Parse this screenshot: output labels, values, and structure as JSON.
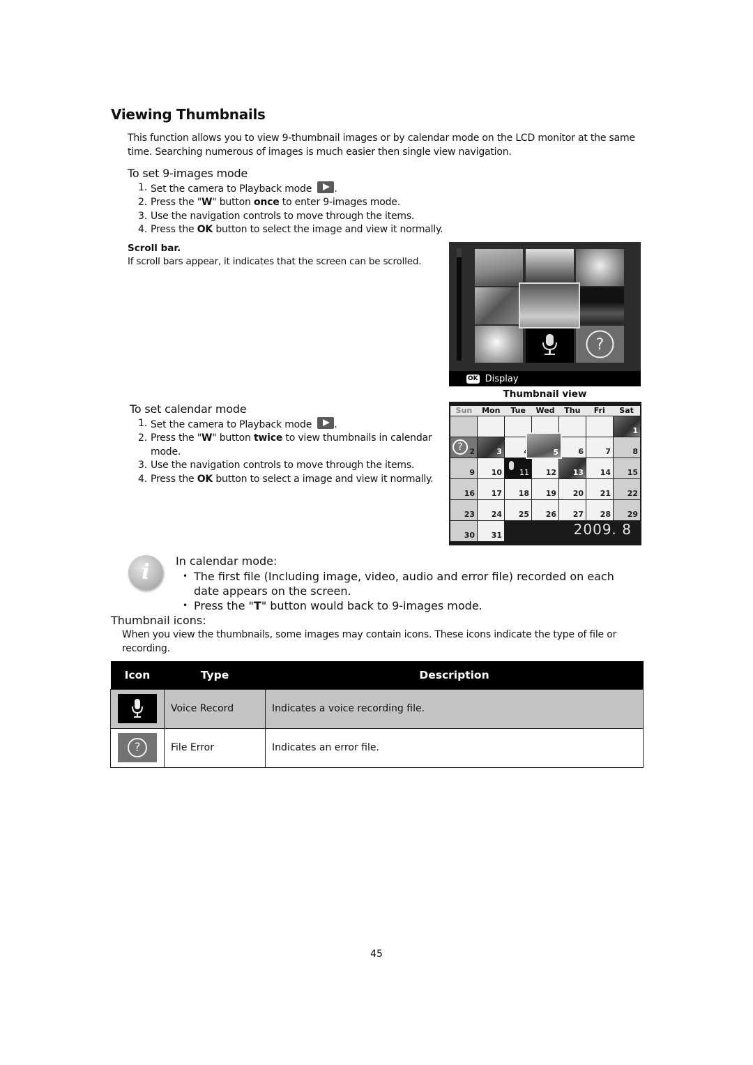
{
  "page": {
    "title": "Viewing Thumbnails",
    "intro": "This function allows you to view 9-thumbnail images or by calendar mode on the LCD monitor at the same time. Searching numerous of images is much easier then single view navigation.",
    "page_number": "45"
  },
  "nine_images": {
    "heading": "To set 9-images mode",
    "steps": [
      {
        "num": "1.",
        "pre": "Set the camera to Playback mode ",
        "bold": "",
        "post": ".",
        "icon": "playback-icon"
      },
      {
        "num": "2.",
        "pre": "Press the \"",
        "bold": "W",
        "mid": "\" button ",
        "bold2": "once",
        "post": " to enter 9-images mode."
      },
      {
        "num": "3.",
        "pre": "Use the navigation controls to move through the items."
      },
      {
        "num": "4.",
        "pre": "Press the ",
        "bold": "OK",
        "post": " button to select the image and view it normally."
      }
    ],
    "scroll_bar_title": "Scroll bar.",
    "scroll_bar_text": "If scroll bars appear, it indicates that the screen can be scrolled."
  },
  "thumbnail_screen": {
    "footer_badge": "OK",
    "footer_label": "Display",
    "caption": "Thumbnail view",
    "tiles": [
      "photo-woman-outdoors",
      "photo-two-children",
      "photo-child",
      "photo-leaves",
      "photo-beach-selected",
      "photo-city-night",
      "photo-girl",
      "voice-record-icon",
      "file-error-icon"
    ]
  },
  "calendar": {
    "heading": "To set calendar mode",
    "steps": [
      {
        "num": "1.",
        "pre": "Set the camera to Playback mode ",
        "post": "."
      },
      {
        "num": "2.",
        "pre": "Press the \"",
        "bold": "W",
        "mid": "\" button ",
        "bold2": "twice",
        "post": " to view thumbnails in calendar mode."
      },
      {
        "num": "3.",
        "pre": "Use the navigation controls to move through the items."
      },
      {
        "num": "4.",
        "pre": "Press the ",
        "bold": "OK",
        "post": " button to select a image and view it normally."
      }
    ],
    "weekdays": [
      "Sun",
      "Mon",
      "Tue",
      "Wed",
      "Thu",
      "Fri",
      "Sat"
    ],
    "days": [
      "",
      "",
      "",
      "",
      "",
      "",
      "1",
      "2",
      "3",
      "4",
      "5",
      "6",
      "7",
      "8",
      "9",
      "10",
      "11",
      "12",
      "13",
      "14",
      "15",
      "16",
      "17",
      "18",
      "19",
      "20",
      "21",
      "22",
      "23",
      "24",
      "25",
      "26",
      "27",
      "28",
      "29",
      "30",
      "31"
    ],
    "year_month": "2009. 8"
  },
  "note": {
    "title": "In calendar mode:",
    "bullets": [
      {
        "pre": "The first file (Including image, video, audio and error file) recorded on each date appears on the screen."
      },
      {
        "pre": "Press the \"",
        "bold": "T",
        "post": "\" button would back to 9-images mode."
      }
    ]
  },
  "icons_section": {
    "heading": "Thumbnail icons:",
    "text": "When you view the thumbnails, some images may contain icons. These icons indicate the type of file or recording.",
    "table": {
      "headers": [
        "Icon",
        "Type",
        "Description"
      ],
      "rows": [
        {
          "icon": "voice-record-icon",
          "type": "Voice Record",
          "description": "Indicates a voice recording file."
        },
        {
          "icon": "file-error-icon",
          "type": "File Error",
          "description": "Indicates an error file."
        }
      ]
    }
  }
}
